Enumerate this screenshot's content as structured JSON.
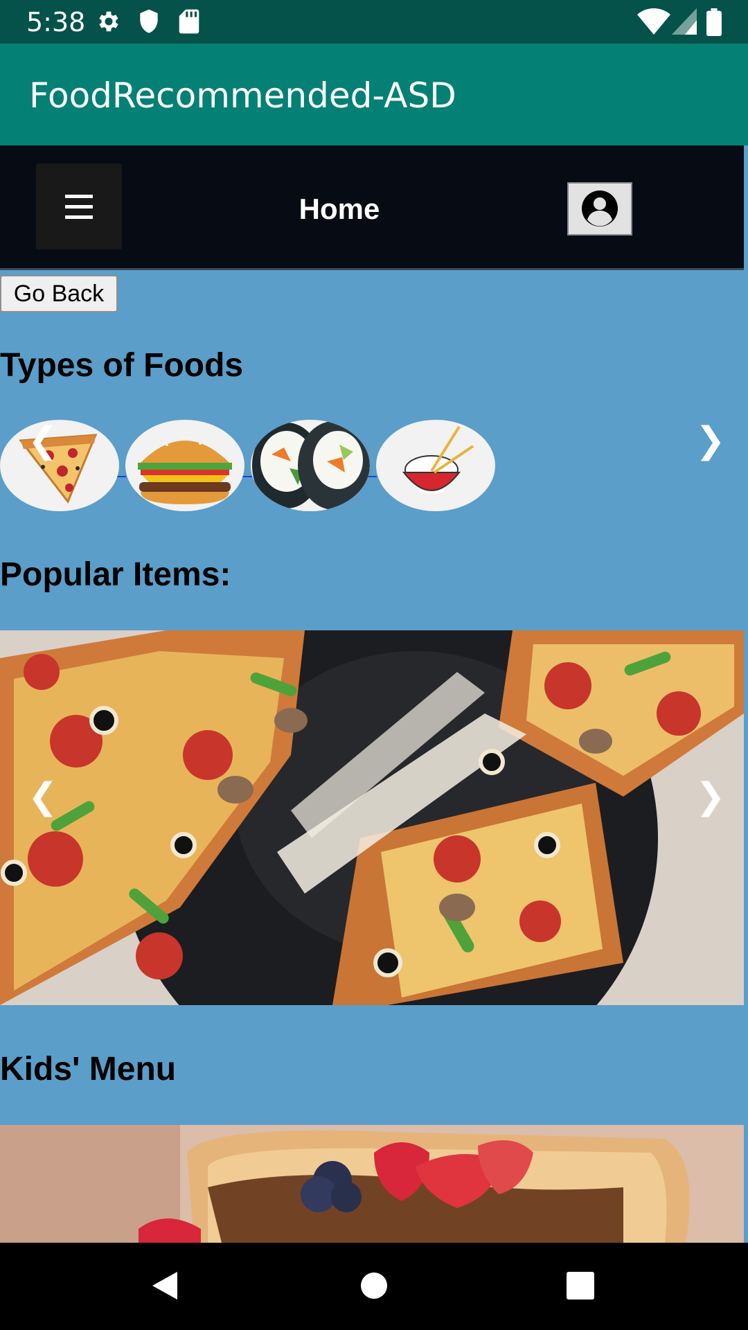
{
  "status_bar": {
    "time": "5:38",
    "icons": [
      "gear-icon",
      "shield-icon",
      "sd-card-icon",
      "wifi-icon",
      "signal-icon",
      "battery-icon"
    ]
  },
  "app_bar": {
    "title": "FoodRecommended-ASD"
  },
  "nav": {
    "title": "Home",
    "menu_icon": "hamburger-menu-icon",
    "profile_icon": "user-account-icon"
  },
  "go_back_label": "Go Back",
  "types_section": {
    "heading": "Types of Foods",
    "items": [
      {
        "name": "Pizza",
        "icon": "pizza-slice"
      },
      {
        "name": "Burger",
        "icon": "burger"
      },
      {
        "name": "Sushi",
        "icon": "sushi-rolls"
      },
      {
        "name": "Rice",
        "icon": "rice-bowl-chopsticks"
      }
    ]
  },
  "popular_section": {
    "heading": "Popular Items:",
    "image": "pizza-photo"
  },
  "kids_section": {
    "heading": "Kids' Menu",
    "image": "french-toast-berries-photo"
  },
  "arrows": {
    "prev": "❮",
    "next": "❯"
  },
  "colors": {
    "status_bar": "#05524a",
    "app_bar": "#058074",
    "page_background": "#5b9ec9",
    "web_navbar": "#060b14"
  }
}
